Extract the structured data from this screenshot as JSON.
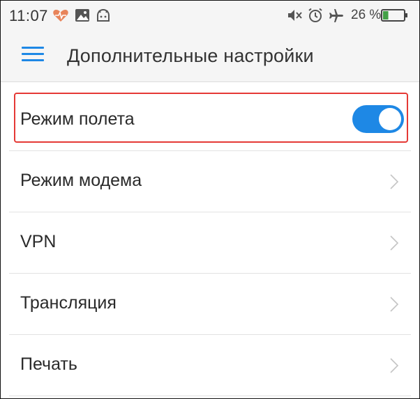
{
  "status_bar": {
    "time": "11:07",
    "battery_percent_text": "26 %",
    "battery_level": 0.26,
    "icons": [
      "heart-rate-icon",
      "image-icon",
      "android-icon",
      "mute-icon",
      "alarm-icon",
      "airplane-icon",
      "battery-icon"
    ],
    "colors": {
      "heart": "#e8845a",
      "battery_fill": "#43a047"
    }
  },
  "header": {
    "menu_icon": "hamburger-menu-icon",
    "title": "Дополнительные настройки",
    "accent_color": "#1e88e5"
  },
  "settings": {
    "items": [
      {
        "label": "Режим полета",
        "control": "toggle",
        "state": "on"
      },
      {
        "label": "Режим модема",
        "control": "chevron"
      },
      {
        "label": "VPN",
        "control": "chevron"
      },
      {
        "label": "Трансляция",
        "control": "chevron"
      },
      {
        "label": "Печать",
        "control": "chevron"
      }
    ]
  },
  "highlight_color": "#e53935"
}
